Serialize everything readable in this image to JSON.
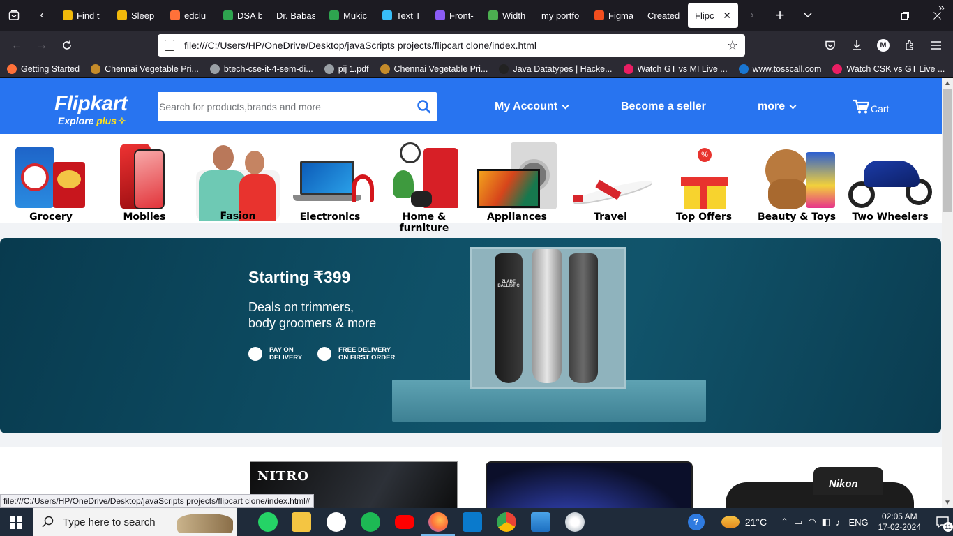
{
  "browser": {
    "tabs": [
      {
        "label": "Find t",
        "color": "#f0b90b"
      },
      {
        "label": "Sleep",
        "color": "#f0b90b"
      },
      {
        "label": "edclu",
        "color": "#ff7139"
      },
      {
        "label": "DSA b",
        "color": "#2ea44f"
      },
      {
        "label": "Dr. Babasa",
        "color": ""
      },
      {
        "label": "Mukic",
        "color": "#2ea44f"
      },
      {
        "label": "Text T",
        "color": "#38bdf8"
      },
      {
        "label": "Front-",
        "color": "#8b5cf6"
      },
      {
        "label": "Width",
        "color": "#4caf50"
      },
      {
        "label": "my portfo",
        "color": ""
      },
      {
        "label": "Figma",
        "color": "#f24e1e"
      },
      {
        "label": "Created by",
        "color": ""
      },
      {
        "label": "Flipcart",
        "color": "",
        "active": true
      }
    ],
    "url": "file:///C:/Users/HP/OneDrive/Desktop/javaScripts projects/flipcart clone/index.html",
    "account_initial": "M",
    "bookmarks": [
      {
        "label": "Getting Started",
        "color": "#ff7139"
      },
      {
        "label": "Chennai Vegetable Pri...",
        "color": "#c58b2a"
      },
      {
        "label": "btech-cse-it-4-sem-di...",
        "color": "#9aa0a6"
      },
      {
        "label": "pij 1.pdf",
        "color": "#9aa0a6"
      },
      {
        "label": "Chennai Vegetable Pri...",
        "color": "#c58b2a"
      },
      {
        "label": "Java Datatypes | Hacke...",
        "color": "#222222"
      },
      {
        "label": "Watch GT vs MI Live ...",
        "color": "#e91e63"
      },
      {
        "label": "www.tosscall.com",
        "color": "#1976d2"
      },
      {
        "label": "Watch CSK vs GT Live ...",
        "color": "#e91e63"
      }
    ],
    "status_url": "file:///C:/Users/HP/OneDrive/Desktop/javaScripts projects/flipcart clone/index.html#"
  },
  "flipkart": {
    "logo": "Flipkart",
    "tagline_explore": "Explore",
    "tagline_plus": "plus",
    "search_placeholder": "Search for products,brands and more",
    "nav": {
      "account": "My Account",
      "seller": "Become a seller",
      "more": "more",
      "cart": "Cart"
    },
    "categories": [
      {
        "label": "Grocery"
      },
      {
        "label": "Mobiles"
      },
      {
        "label": "Fasion"
      },
      {
        "label": "Electronics"
      },
      {
        "label": "Home & furniture"
      },
      {
        "label": "Appliances"
      },
      {
        "label": "Travel"
      },
      {
        "label": "Top Offers"
      },
      {
        "label": "Beauty & Toys"
      },
      {
        "label": "Two Wheelers"
      }
    ],
    "banner": {
      "title": "Starting ₹399",
      "subtitle": "Deals on trimmers,\nbody groomers & more",
      "badge1": "PAY ON DELIVERY",
      "badge2": "FREE DELIVERY ON FIRST ORDER",
      "brand_mark": "ZLADE BALLISTIC"
    },
    "products": {
      "laptop_brand": "NITRO",
      "camera_brand": "Nikon"
    }
  },
  "taskbar": {
    "search_placeholder": "Type here to search",
    "weather": "21°C",
    "language": "ENG",
    "time": "02:05 AM",
    "date": "17-02-2024",
    "notifications": "11"
  }
}
